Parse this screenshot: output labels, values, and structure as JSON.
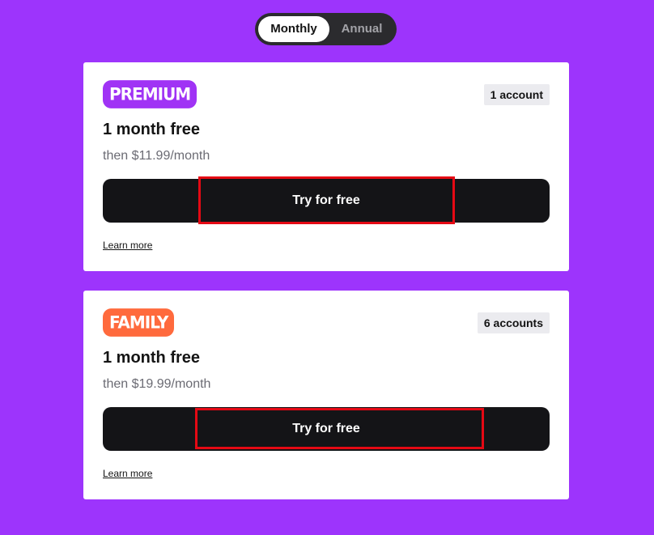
{
  "toggle": {
    "monthly_label": "Monthly",
    "annual_label": "Annual",
    "selected": "Monthly"
  },
  "plans": [
    {
      "badge": "PREMIUM",
      "badge_color": "#a033f5",
      "accounts": "1 account",
      "headline": "1 month free",
      "price": "then $11.99/month",
      "cta": "Try for free",
      "learn_more": "Learn more"
    },
    {
      "badge": "FAMILY",
      "badge_color": "#ff6a3d",
      "accounts": "6 accounts",
      "headline": "1 month free",
      "price": "then $19.99/month",
      "cta": "Try for free",
      "learn_more": "Learn more"
    }
  ],
  "colors": {
    "background": "#9d34fc",
    "button": "#141417",
    "highlight": "#e50914"
  }
}
